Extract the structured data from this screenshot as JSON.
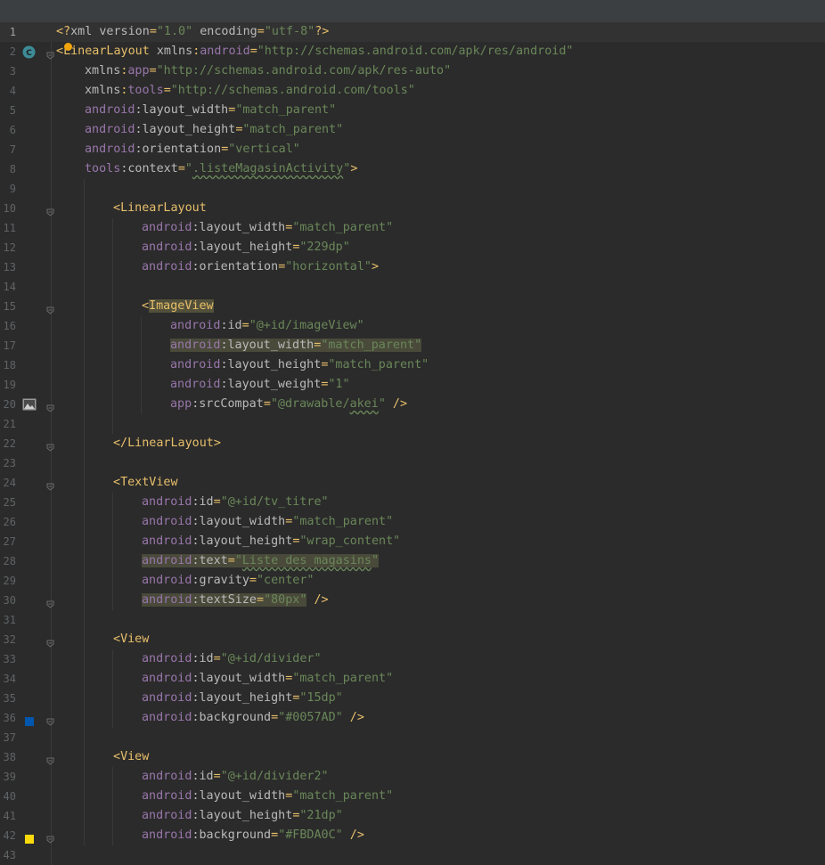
{
  "editor": {
    "language": "XML",
    "lines": [
      {
        "n": "1",
        "indent": 0,
        "tokens": [
          [
            "punc",
            "<?"
          ],
          [
            "attr",
            "xml version"
          ],
          [
            "punc",
            "="
          ],
          [
            "str",
            "\"1.0\""
          ],
          [
            "attr",
            " encoding"
          ],
          [
            "punc",
            "="
          ],
          [
            "str",
            "\"utf-8\""
          ],
          [
            "punc",
            "?>"
          ]
        ]
      },
      {
        "n": "2",
        "indent": 0,
        "tokens": [
          [
            "punc",
            "<"
          ],
          [
            "tag",
            "LinearLayout"
          ],
          [
            "attr",
            " xmlns"
          ],
          [
            "punc",
            ":"
          ],
          [
            "ns",
            "android"
          ],
          [
            "punc",
            "="
          ],
          [
            "str",
            "\"http://schemas.android.com/apk/res/android\""
          ]
        ]
      },
      {
        "n": "3",
        "indent": 1,
        "tokens": [
          [
            "attr",
            "xmlns"
          ],
          [
            "punc",
            ":"
          ],
          [
            "ns",
            "app"
          ],
          [
            "punc",
            "="
          ],
          [
            "str",
            "\"http://schemas.android.com/apk/res-auto\""
          ]
        ]
      },
      {
        "n": "4",
        "indent": 1,
        "tokens": [
          [
            "attr",
            "xmlns"
          ],
          [
            "punc",
            ":"
          ],
          [
            "ns",
            "tools"
          ],
          [
            "punc",
            "="
          ],
          [
            "str",
            "\"http://schemas.android.com/tools\""
          ]
        ]
      },
      {
        "n": "5",
        "indent": 1,
        "tokens": [
          [
            "ns",
            "android"
          ],
          [
            "attr",
            ":layout_width"
          ],
          [
            "punc",
            "="
          ],
          [
            "str",
            "\"match_parent\""
          ]
        ]
      },
      {
        "n": "6",
        "indent": 1,
        "tokens": [
          [
            "ns",
            "android"
          ],
          [
            "attr",
            ":layout_height"
          ],
          [
            "punc",
            "="
          ],
          [
            "str",
            "\"match_parent\""
          ]
        ]
      },
      {
        "n": "7",
        "indent": 1,
        "tokens": [
          [
            "ns",
            "android"
          ],
          [
            "attr",
            ":orientation"
          ],
          [
            "punc",
            "="
          ],
          [
            "str",
            "\"vertical\""
          ]
        ]
      },
      {
        "n": "8",
        "indent": 1,
        "tokens": [
          [
            "ns",
            "tools"
          ],
          [
            "attr",
            ":context"
          ],
          [
            "punc",
            "="
          ],
          [
            "str",
            "\""
          ],
          [
            "strsq",
            ".listeMagasinActivity"
          ],
          [
            "str",
            "\""
          ],
          [
            "punc",
            ">"
          ]
        ]
      },
      {
        "n": "9",
        "indent": 0,
        "tokens": []
      },
      {
        "n": "10",
        "indent": 2,
        "tokens": [
          [
            "punc",
            "<"
          ],
          [
            "tag",
            "LinearLayout"
          ]
        ]
      },
      {
        "n": "11",
        "indent": 3,
        "tokens": [
          [
            "ns",
            "android"
          ],
          [
            "attr",
            ":layout_width"
          ],
          [
            "punc",
            "="
          ],
          [
            "str",
            "\"match_parent\""
          ]
        ]
      },
      {
        "n": "12",
        "indent": 3,
        "tokens": [
          [
            "ns",
            "android"
          ],
          [
            "attr",
            ":layout_height"
          ],
          [
            "punc",
            "="
          ],
          [
            "str",
            "\"229dp\""
          ]
        ]
      },
      {
        "n": "13",
        "indent": 3,
        "tokens": [
          [
            "ns",
            "android"
          ],
          [
            "attr",
            ":orientation"
          ],
          [
            "punc",
            "="
          ],
          [
            "str",
            "\"horizontal\""
          ],
          [
            "punc",
            ">"
          ]
        ]
      },
      {
        "n": "14",
        "indent": 0,
        "tokens": []
      },
      {
        "n": "15",
        "indent": 3,
        "tokens": [
          [
            "punc",
            "<"
          ],
          [
            "taghl",
            "ImageView"
          ]
        ]
      },
      {
        "n": "16",
        "indent": 4,
        "tokens": [
          [
            "ns",
            "android"
          ],
          [
            "attr",
            ":id"
          ],
          [
            "punc",
            "="
          ],
          [
            "str",
            "\"@+id/imageView\""
          ]
        ]
      },
      {
        "n": "17",
        "indent": 4,
        "hl": true,
        "tokens": [
          [
            "ns",
            "android"
          ],
          [
            "attr",
            ":layout_width"
          ],
          [
            "punc",
            "="
          ],
          [
            "str",
            "\"match_parent\""
          ]
        ]
      },
      {
        "n": "18",
        "indent": 4,
        "tokens": [
          [
            "ns",
            "android"
          ],
          [
            "attr",
            ":layout_height"
          ],
          [
            "punc",
            "="
          ],
          [
            "str",
            "\"match_parent\""
          ]
        ]
      },
      {
        "n": "19",
        "indent": 4,
        "tokens": [
          [
            "ns",
            "android"
          ],
          [
            "attr",
            ":layout_weight"
          ],
          [
            "punc",
            "="
          ],
          [
            "str",
            "\"1\""
          ]
        ]
      },
      {
        "n": "20",
        "indent": 4,
        "tokens": [
          [
            "ns",
            "app"
          ],
          [
            "attr",
            ":srcCompat"
          ],
          [
            "punc",
            "="
          ],
          [
            "str",
            "\"@drawable/"
          ],
          [
            "strsq",
            "akei"
          ],
          [
            "str",
            "\""
          ],
          [
            "punc",
            " />"
          ]
        ]
      },
      {
        "n": "21",
        "indent": 0,
        "tokens": []
      },
      {
        "n": "22",
        "indent": 2,
        "tokens": [
          [
            "punc",
            "</"
          ],
          [
            "tag",
            "LinearLayout"
          ],
          [
            "punc",
            ">"
          ]
        ]
      },
      {
        "n": "23",
        "indent": 0,
        "tokens": []
      },
      {
        "n": "24",
        "indent": 2,
        "tokens": [
          [
            "punc",
            "<"
          ],
          [
            "tag",
            "TextView"
          ]
        ]
      },
      {
        "n": "25",
        "indent": 3,
        "tokens": [
          [
            "ns",
            "android"
          ],
          [
            "attr",
            ":id"
          ],
          [
            "punc",
            "="
          ],
          [
            "str",
            "\"@+id/tv_titre\""
          ]
        ]
      },
      {
        "n": "26",
        "indent": 3,
        "tokens": [
          [
            "ns",
            "android"
          ],
          [
            "attr",
            ":layout_width"
          ],
          [
            "punc",
            "="
          ],
          [
            "str",
            "\"match_parent\""
          ]
        ]
      },
      {
        "n": "27",
        "indent": 3,
        "tokens": [
          [
            "ns",
            "android"
          ],
          [
            "attr",
            ":layout_height"
          ],
          [
            "punc",
            "="
          ],
          [
            "str",
            "\"wrap_content\""
          ]
        ]
      },
      {
        "n": "28",
        "indent": 3,
        "hl": true,
        "tokens": [
          [
            "ns",
            "android"
          ],
          [
            "attr",
            ":text"
          ],
          [
            "punc",
            "="
          ],
          [
            "str",
            "\""
          ],
          [
            "strsq",
            "Liste des magasins"
          ],
          [
            "str",
            "\""
          ]
        ]
      },
      {
        "n": "29",
        "indent": 3,
        "tokens": [
          [
            "ns",
            "android"
          ],
          [
            "attr",
            ":gravity"
          ],
          [
            "punc",
            "="
          ],
          [
            "str",
            "\"center\""
          ]
        ]
      },
      {
        "n": "30",
        "indent": 3,
        "hlpart": true,
        "tokens": [
          [
            "ns",
            "android"
          ],
          [
            "attr",
            ":textSize"
          ],
          [
            "punc",
            "="
          ],
          [
            "str",
            "\"80px\""
          ],
          [
            "punc",
            " />"
          ]
        ]
      },
      {
        "n": "31",
        "indent": 0,
        "tokens": []
      },
      {
        "n": "32",
        "indent": 2,
        "tokens": [
          [
            "punc",
            "<"
          ],
          [
            "tag",
            "View"
          ]
        ]
      },
      {
        "n": "33",
        "indent": 3,
        "tokens": [
          [
            "ns",
            "android"
          ],
          [
            "attr",
            ":id"
          ],
          [
            "punc",
            "="
          ],
          [
            "str",
            "\"@+id/divider\""
          ]
        ]
      },
      {
        "n": "34",
        "indent": 3,
        "tokens": [
          [
            "ns",
            "android"
          ],
          [
            "attr",
            ":layout_width"
          ],
          [
            "punc",
            "="
          ],
          [
            "str",
            "\"match_parent\""
          ]
        ]
      },
      {
        "n": "35",
        "indent": 3,
        "tokens": [
          [
            "ns",
            "android"
          ],
          [
            "attr",
            ":layout_height"
          ],
          [
            "punc",
            "="
          ],
          [
            "str",
            "\"15dp\""
          ]
        ]
      },
      {
        "n": "36",
        "indent": 3,
        "tokens": [
          [
            "ns",
            "android"
          ],
          [
            "attr",
            ":background"
          ],
          [
            "punc",
            "="
          ],
          [
            "str",
            "\"#0057AD\""
          ],
          [
            "punc",
            " />"
          ]
        ]
      },
      {
        "n": "37",
        "indent": 0,
        "tokens": []
      },
      {
        "n": "38",
        "indent": 2,
        "tokens": [
          [
            "punc",
            "<"
          ],
          [
            "tag",
            "View"
          ]
        ]
      },
      {
        "n": "39",
        "indent": 3,
        "tokens": [
          [
            "ns",
            "android"
          ],
          [
            "attr",
            ":id"
          ],
          [
            "punc",
            "="
          ],
          [
            "str",
            "\"@+id/divider2\""
          ]
        ]
      },
      {
        "n": "40",
        "indent": 3,
        "tokens": [
          [
            "ns",
            "android"
          ],
          [
            "attr",
            ":layout_width"
          ],
          [
            "punc",
            "="
          ],
          [
            "str",
            "\"match_parent\""
          ]
        ]
      },
      {
        "n": "41",
        "indent": 3,
        "tokens": [
          [
            "ns",
            "android"
          ],
          [
            "attr",
            ":layout_height"
          ],
          [
            "punc",
            "="
          ],
          [
            "str",
            "\"21dp\""
          ]
        ]
      },
      {
        "n": "42",
        "indent": 3,
        "tokens": [
          [
            "ns",
            "android"
          ],
          [
            "attr",
            ":background"
          ],
          [
            "punc",
            "="
          ],
          [
            "str",
            "\"#FBDA0C\""
          ],
          [
            "punc",
            " />"
          ]
        ]
      },
      {
        "n": "43",
        "indent": 0,
        "tokens": []
      }
    ],
    "gutter_icons": {
      "2": "class-c-icon",
      "20": "image-preview-icon",
      "36": "color-swatch-icon",
      "42": "color-swatch-icon"
    },
    "swatch_colors": {
      "36": "#0057AD",
      "42": "#FBDA0C"
    },
    "fold_lines": [
      "2",
      "10",
      "15",
      "20",
      "22",
      "24",
      "30",
      "32",
      "36",
      "38",
      "42"
    ],
    "current_line": "1"
  }
}
